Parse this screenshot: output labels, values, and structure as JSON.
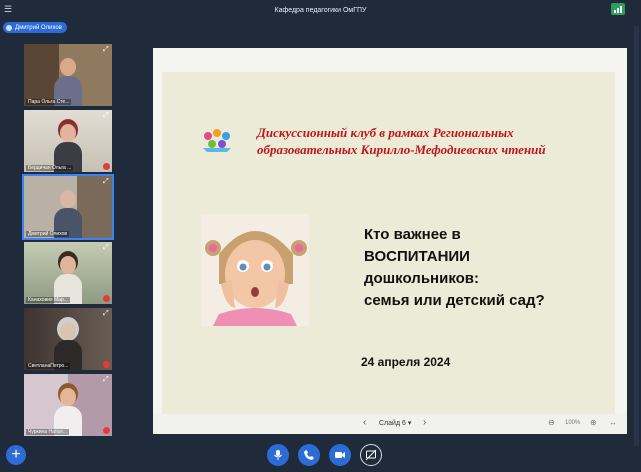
{
  "window": {
    "title": "Кафедра педагогики ОмГПУ"
  },
  "presenter": {
    "name": "Дмитрий Олихов"
  },
  "participants": [
    {
      "name": "Пара Ольга Сте..."
    },
    {
      "name": "Бердичан Ольга ..."
    },
    {
      "name": "Дмитрий Олихов"
    },
    {
      "name": "Канаховия Мар..."
    },
    {
      "name": "СветланаПетро..."
    },
    {
      "name": "Чуркина Натал..."
    }
  ],
  "slide": {
    "club_line1": "Дискуссионный клуб в рамках Региональных",
    "club_line2": "образовательных Кирилло-Мефодиевских чтений",
    "question_line1": "Кто важнее в",
    "question_line2": "ВОСПИТАНИИ",
    "question_line3": "дошкольников:",
    "question_line4": "семья или детский сад?",
    "date": "24 апреля 2024"
  },
  "slide_controls": {
    "slide_label": "Слайд 6",
    "zoom": "100%"
  },
  "colors": {
    "accent": "#2d6bd6",
    "title_red": "#c0161b",
    "background": "#1f2a3a",
    "slide_bg": "#ecebd7"
  }
}
